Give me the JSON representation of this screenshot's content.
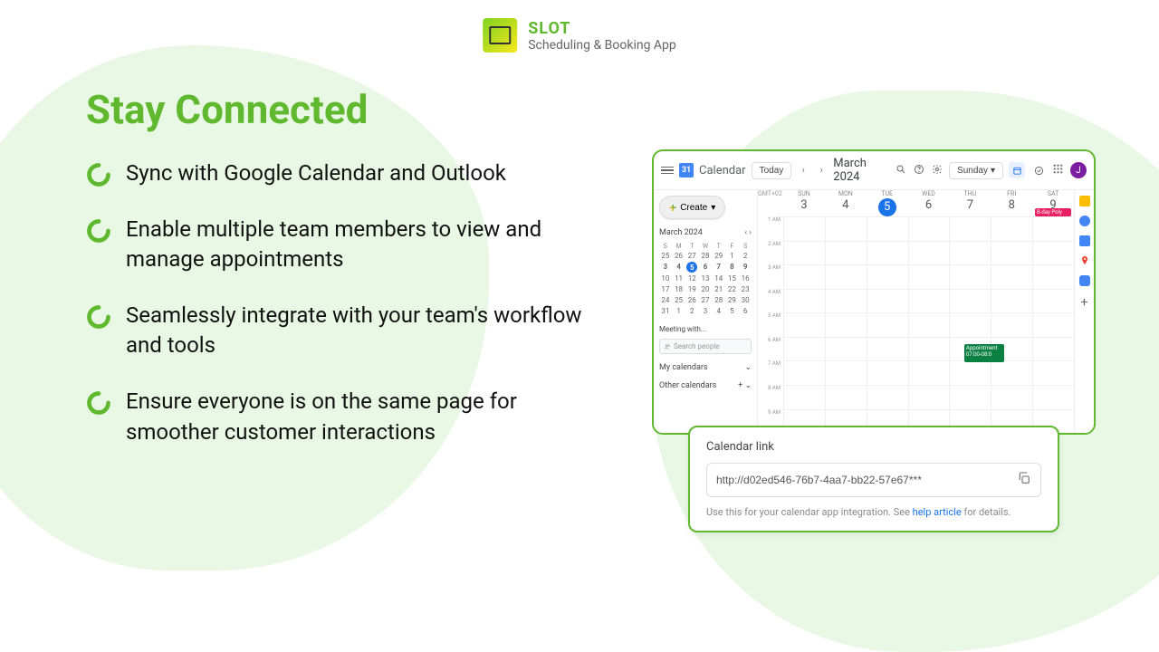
{
  "brand": {
    "name": "SLOT",
    "tagline": "Scheduling & Booking App"
  },
  "page": {
    "title": "Stay Connected"
  },
  "bullets": [
    "Sync with Google Calendar and Outlook",
    "Enable multiple team members to view and manage appointments",
    "Seamlessly integrate with your team's workflow and tools",
    "Ensure everyone is on the same page for smoother customer interactions"
  ],
  "calendar": {
    "app_name": "Calendar",
    "today_btn": "Today",
    "month_label": "March 2024",
    "view_btn": "Sunday",
    "create_btn": "Create",
    "mini_month": "March 2024",
    "mini_dow": [
      "S",
      "M",
      "T",
      "W",
      "T",
      "F",
      "S"
    ],
    "mini_weeks": [
      [
        "25",
        "26",
        "27",
        "28",
        "29",
        "1",
        "2"
      ],
      [
        "3",
        "4",
        "5",
        "6",
        "7",
        "8",
        "9"
      ],
      [
        "10",
        "11",
        "12",
        "13",
        "14",
        "15",
        "16"
      ],
      [
        "17",
        "18",
        "19",
        "20",
        "21",
        "22",
        "23"
      ],
      [
        "24",
        "25",
        "26",
        "27",
        "28",
        "29",
        "30"
      ],
      [
        "31",
        "1",
        "2",
        "3",
        "4",
        "5",
        "6"
      ]
    ],
    "meeting_label": "Meeting with...",
    "search_placeholder": "Search people",
    "my_cal": "My calendars",
    "other_cal": "Other calendars",
    "tz": "GMT+02",
    "days": [
      {
        "dow": "SUN",
        "num": "3"
      },
      {
        "dow": "MON",
        "num": "4"
      },
      {
        "dow": "TUE",
        "num": "5",
        "today": true
      },
      {
        "dow": "WED",
        "num": "6"
      },
      {
        "dow": "THU",
        "num": "7"
      },
      {
        "dow": "FRI",
        "num": "8"
      },
      {
        "dow": "SAT",
        "num": "9"
      }
    ],
    "hours": [
      "1 AM",
      "2 AM",
      "3 AM",
      "4 AM",
      "5 AM",
      "6 AM",
      "7 AM",
      "8 AM",
      "9 AM"
    ],
    "events": {
      "appt": {
        "title": "Appointment",
        "time": "07:00-08:0"
      },
      "bday": {
        "title": "B-day Poly"
      }
    },
    "avatar": "J"
  },
  "link_card": {
    "title": "Calendar link",
    "url": "http://d02ed546-76b7-4aa7-bb22-57e67***",
    "help_pre": "Use this for your calendar app integration. See ",
    "help_link": "help article",
    "help_post": " for details."
  }
}
